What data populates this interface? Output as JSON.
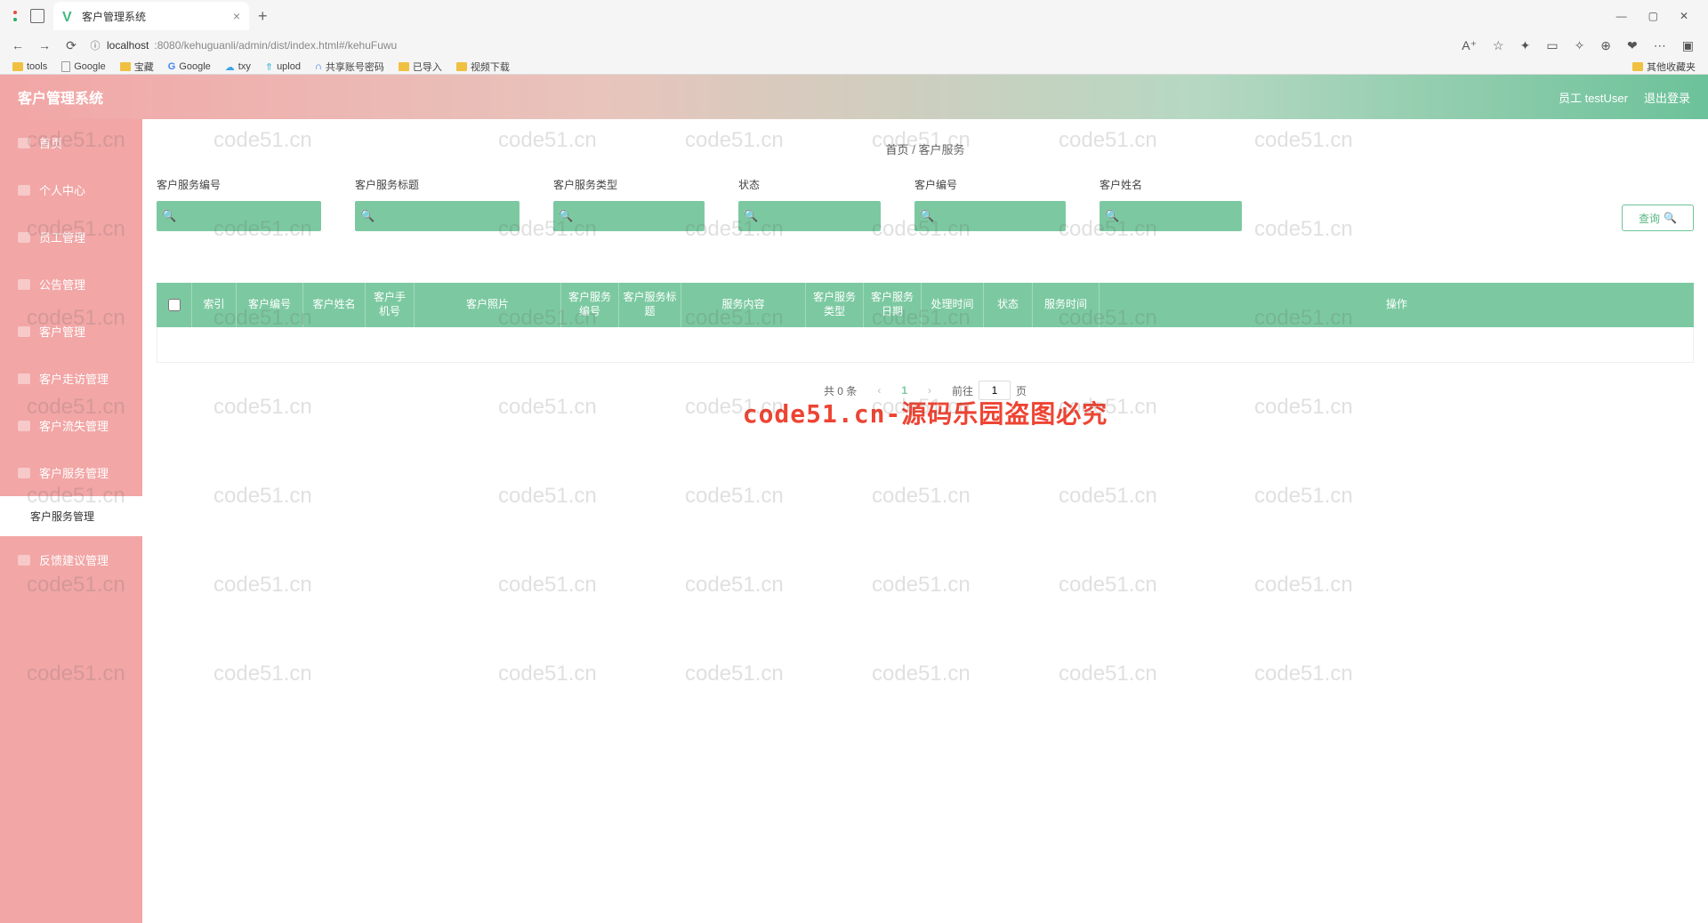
{
  "browser": {
    "tab_title": "客户管理系统",
    "url_host": "localhost",
    "url_path": ":8080/kehuguanli/admin/dist/index.html#/kehuFuwu",
    "bookmarks": [
      "tools",
      "Google",
      "宝藏",
      "Google",
      "txy",
      "uplod",
      "共享账号密码",
      "已导入",
      "视频下载"
    ],
    "bookmark_other": "其他收藏夹",
    "win": {
      "min": "—",
      "max": "▢",
      "close": "✕"
    }
  },
  "app": {
    "title": "客户管理系统",
    "user_info": "员工 testUser",
    "logout": "退出登录"
  },
  "sidebar": {
    "items": [
      {
        "label": "首页"
      },
      {
        "label": "个人中心"
      },
      {
        "label": "员工管理"
      },
      {
        "label": "公告管理"
      },
      {
        "label": "客户管理"
      },
      {
        "label": "客户走访管理"
      },
      {
        "label": "客户流失管理"
      },
      {
        "label": "客户服务管理"
      },
      {
        "label": "反馈建议管理"
      }
    ],
    "sub_active": "客户服务管理"
  },
  "breadcrumb": {
    "home": "首页",
    "sep": "/",
    "current": "客户服务"
  },
  "search": {
    "fields": [
      {
        "label": "客户服务编号"
      },
      {
        "label": "客户服务标题"
      },
      {
        "label": "客户服务类型"
      },
      {
        "label": "状态"
      },
      {
        "label": "客户编号"
      },
      {
        "label": "客户姓名"
      }
    ],
    "query_btn": "查询"
  },
  "table": {
    "columns": [
      "索引",
      "客户编号",
      "客户姓名",
      "客户手机号",
      "客户照片",
      "客户服务编号",
      "客户服务标题",
      "服务内容",
      "客户服务类型",
      "客户服务日期",
      "处理时间",
      "状态",
      "服务时间",
      "操作"
    ]
  },
  "pagination": {
    "total_text": "共 0 条",
    "page": "1",
    "jump_prefix": "前往",
    "jump_suffix": "页",
    "jump_value": "1"
  },
  "overlay_text": "code51.cn-源码乐园盗图必究",
  "watermark": "code51.cn"
}
